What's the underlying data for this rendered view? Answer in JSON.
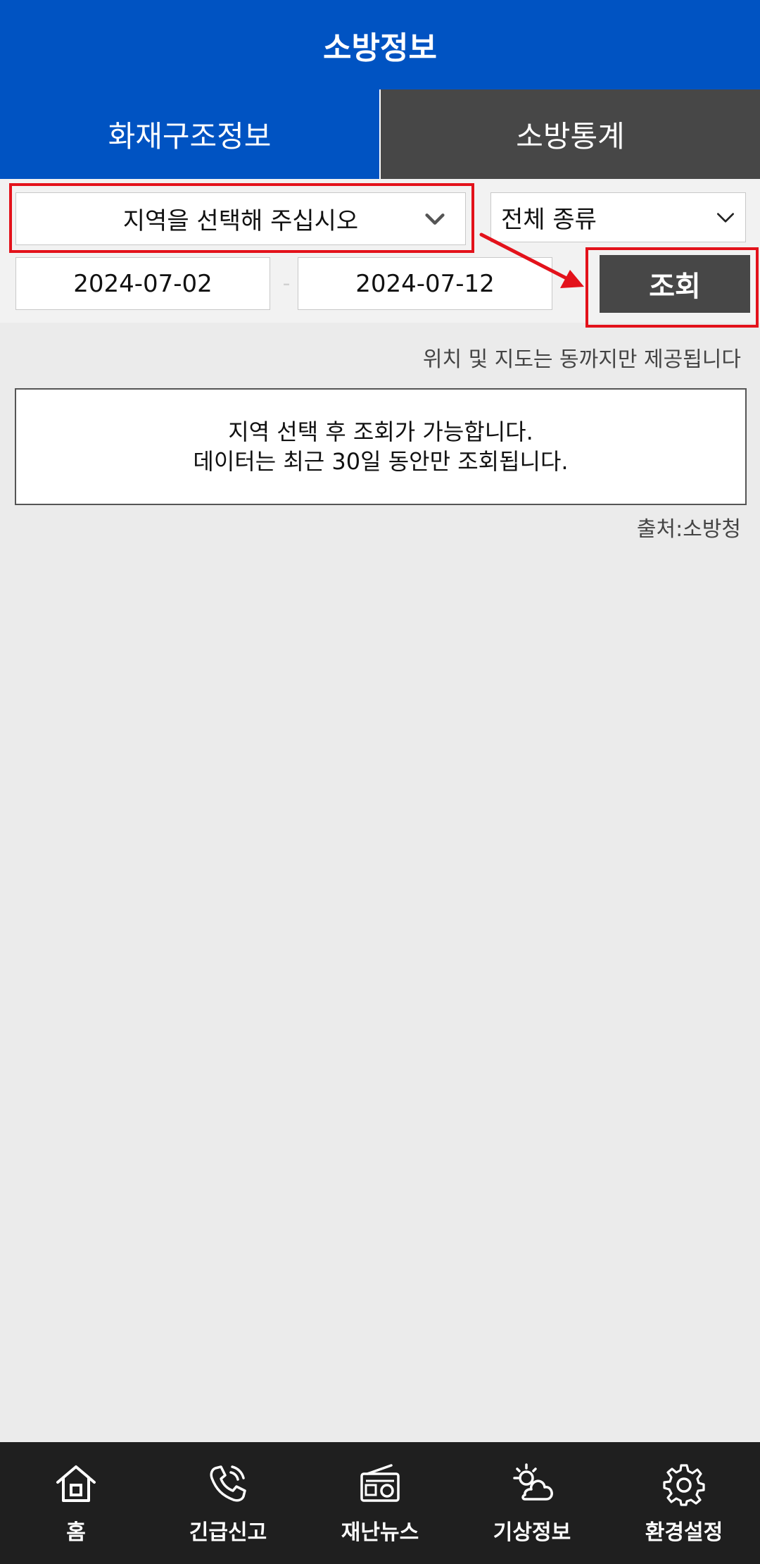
{
  "header": {
    "title": "소방정보"
  },
  "tabs": [
    {
      "label": "화재구조정보"
    },
    {
      "label": "소방통계"
    }
  ],
  "filters": {
    "region_select": {
      "value": "지역을 선택해 주십시오"
    },
    "type_select": {
      "value": "전체 종류"
    },
    "start_date": "2024-07-02",
    "date_separator": "-",
    "end_date": "2024-07-12",
    "search_label": "조회"
  },
  "notice": "위치 및 지도는 동까지만 제공됩니다",
  "message": {
    "line1": "지역 선택 후 조회가 가능합니다.",
    "line2": "데이터는 최근 30일 동안만 조회됩니다."
  },
  "source": "출처:소방청",
  "bottom_nav": [
    {
      "label": "홈",
      "icon": "home-icon"
    },
    {
      "label": "긴급신고",
      "icon": "phone-icon"
    },
    {
      "label": "재난뉴스",
      "icon": "radio-icon"
    },
    {
      "label": "기상정보",
      "icon": "weather-icon"
    },
    {
      "label": "환경설정",
      "icon": "gear-icon"
    }
  ],
  "colors": {
    "primary": "#0053c2",
    "dark": "#474747",
    "highlight": "#e3121b",
    "nav_bg": "#1f1f1f"
  }
}
